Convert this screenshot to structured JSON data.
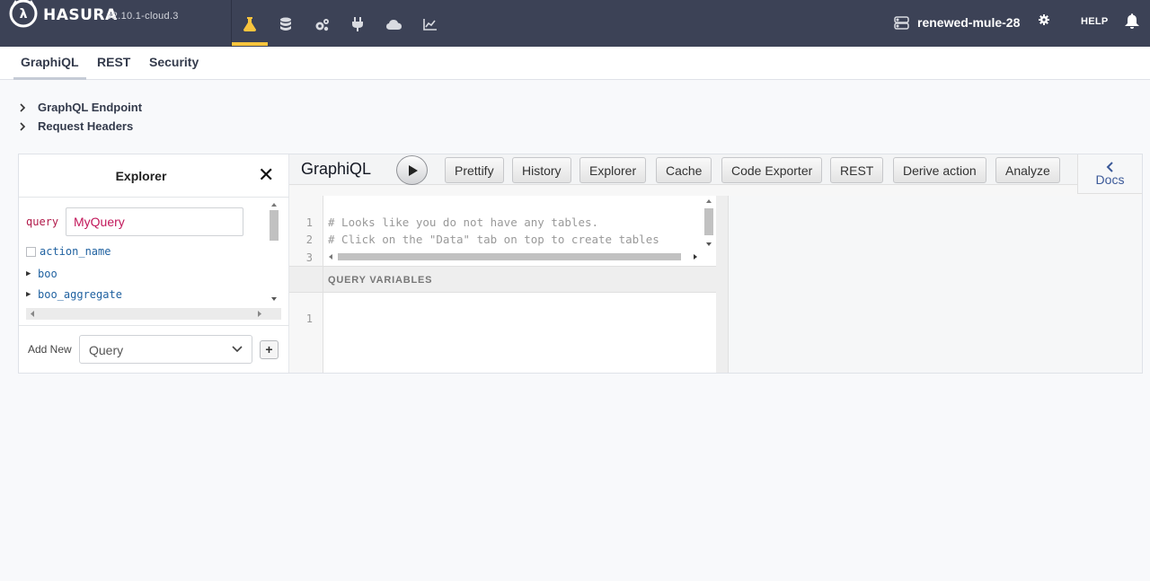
{
  "topbar": {
    "brand": "HASURA",
    "version": "v2.10.1-cloud.3",
    "project_name": "renewed-mule-28",
    "help_label": "HELP",
    "nav_icons": [
      "api-flask-icon",
      "data-database-icon",
      "actions-cogs-icon",
      "remote-schemas-plug-icon",
      "events-cloud-icon",
      "monitoring-chart-icon"
    ],
    "accent_color": "#f8c43d"
  },
  "subnav": {
    "tabs": [
      {
        "label": "GraphiQL",
        "active": true
      },
      {
        "label": "REST",
        "active": false
      },
      {
        "label": "Security",
        "active": false
      }
    ]
  },
  "sections": {
    "endpoint_label": "GraphQL Endpoint",
    "headers_label": "Request Headers"
  },
  "explorer": {
    "title": "Explorer",
    "close_glyph": "✕",
    "operation_keyword": "query",
    "operation_name": "MyQuery",
    "fields": [
      {
        "name": "action_name",
        "kind": "checkbox"
      },
      {
        "name": "boo",
        "kind": "expandable"
      },
      {
        "name": "boo_aggregate",
        "kind": "expandable"
      }
    ],
    "add_new_label": "Add New",
    "add_new_selected": "Query",
    "add_button_label": "+"
  },
  "graphiql": {
    "title": "GraphiQL",
    "toolbar_buttons": [
      "Prettify",
      "History",
      "Explorer",
      "Cache",
      "Code Exporter",
      "REST",
      "Derive action",
      "Analyze"
    ],
    "docs_label": "Docs",
    "editor_lines": [
      {
        "num": "1",
        "text": "# Looks like you do not have any tables."
      },
      {
        "num": "2",
        "text": "# Click on the \"Data\" tab on top to create tables"
      },
      {
        "num": "3",
        "text": ""
      }
    ],
    "query_variables_label": "QUERY VARIABLES",
    "variables_lines": [
      {
        "num": "1",
        "text": ""
      }
    ]
  }
}
